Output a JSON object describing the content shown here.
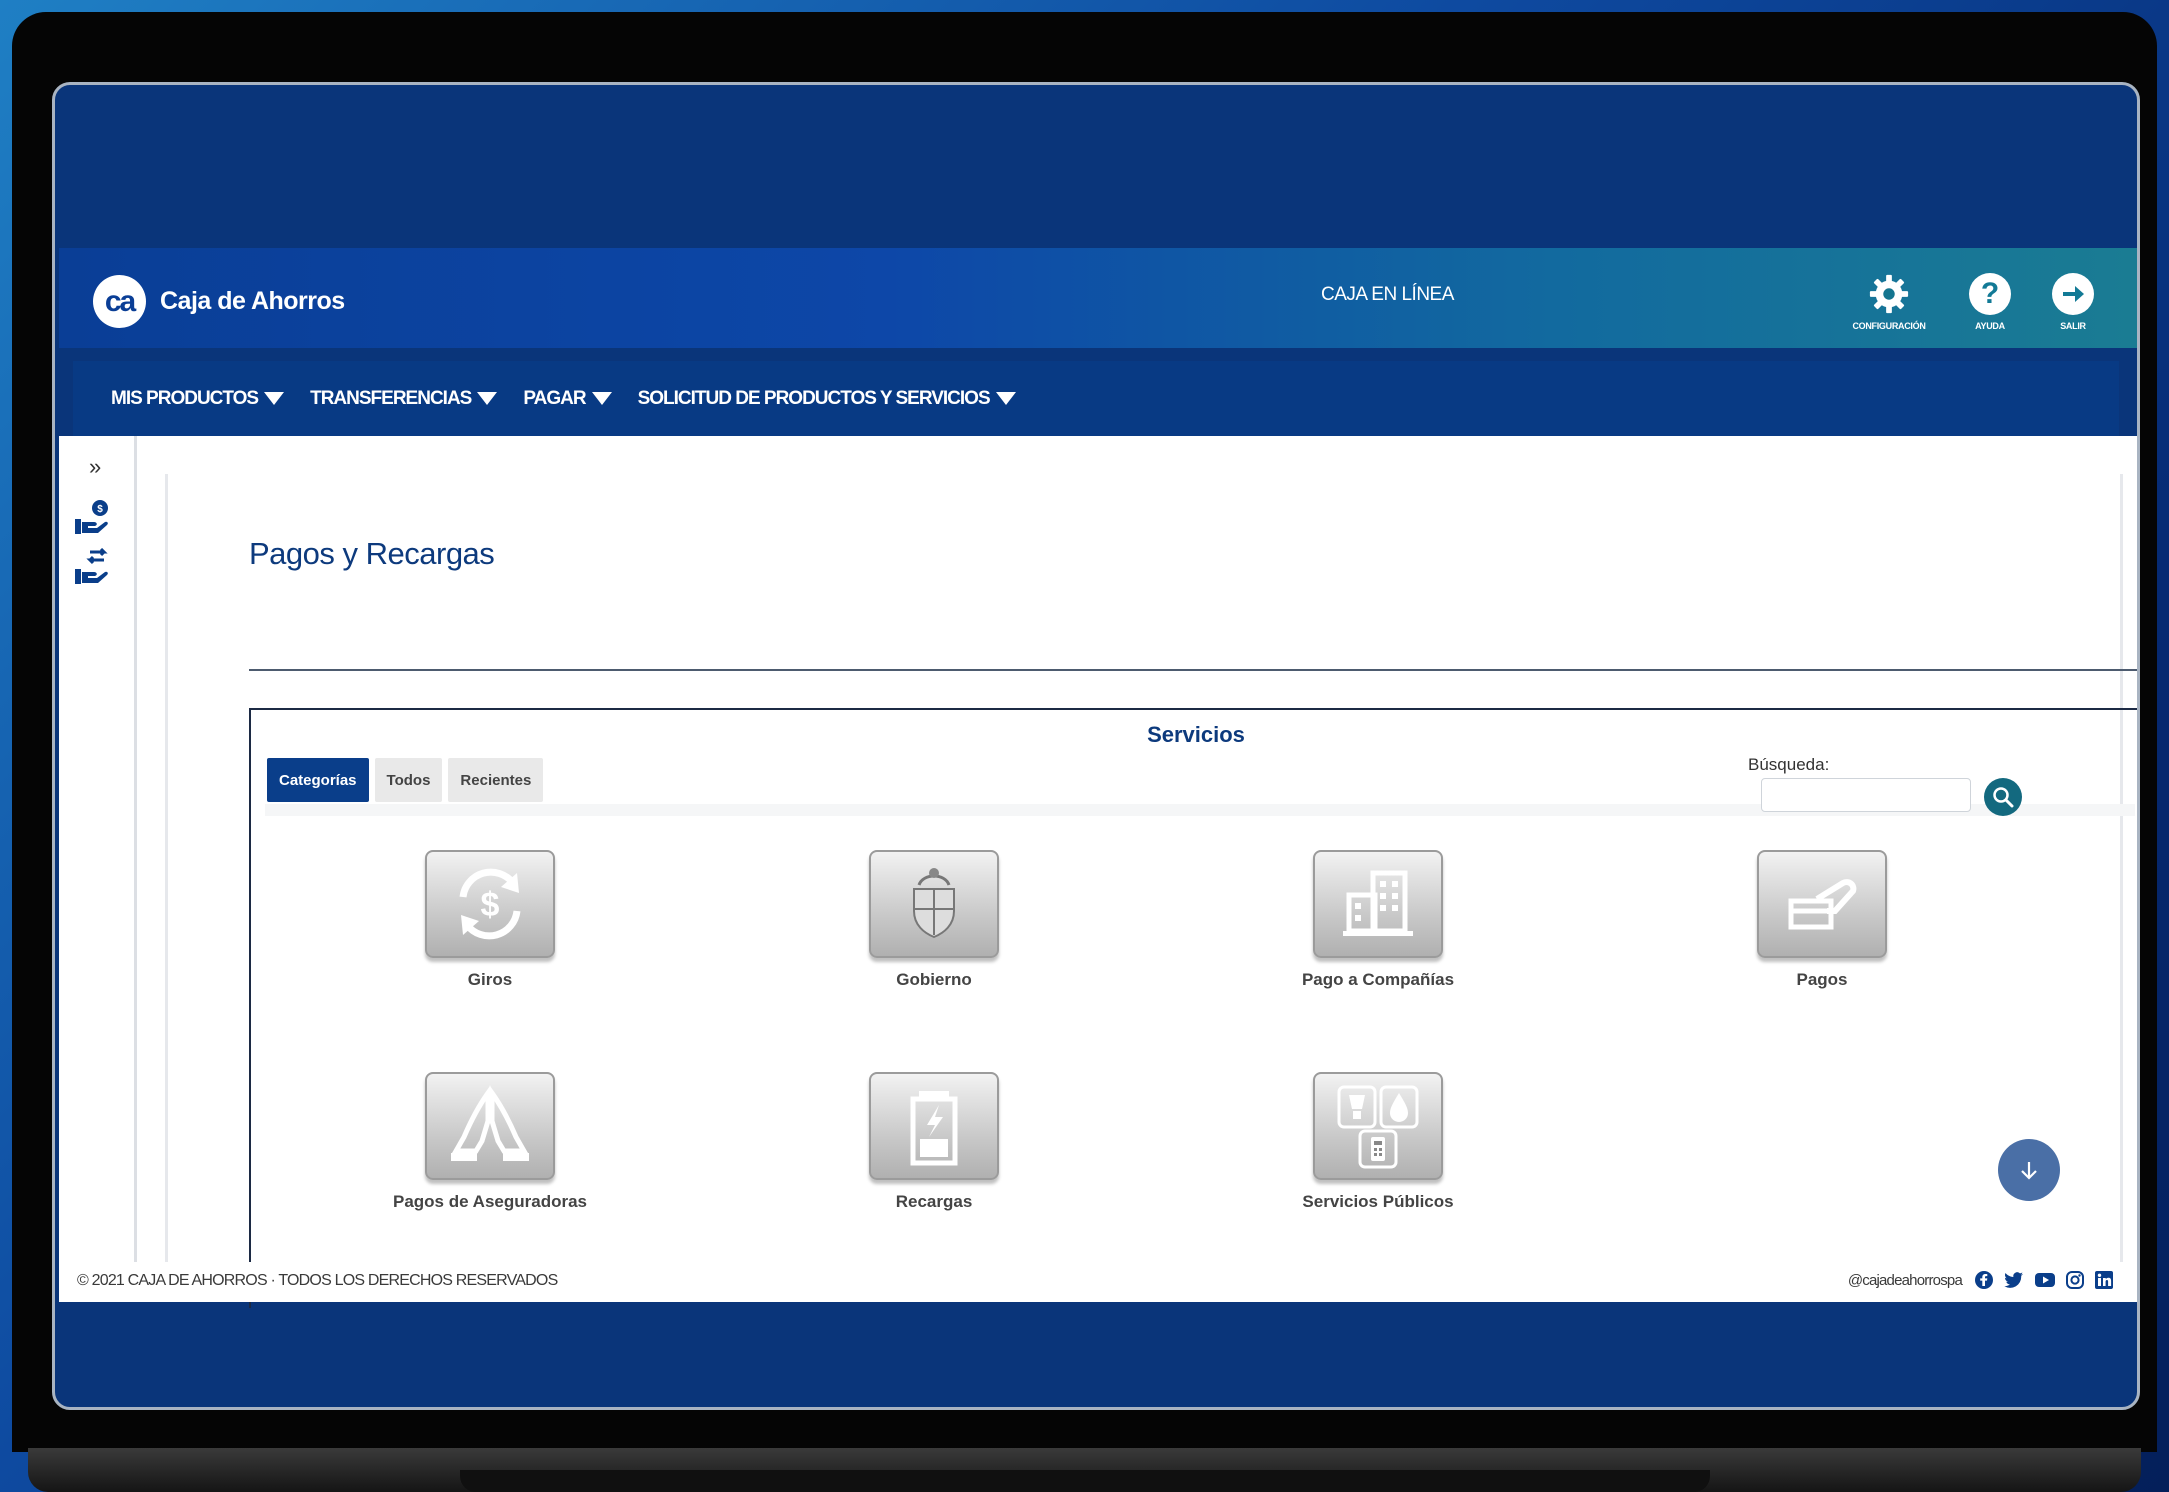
{
  "header": {
    "logo_mark": "ca",
    "logo_text": "Caja de Ahorros",
    "title": "CAJA EN LÍNEA",
    "buttons": [
      {
        "label": "CONFIGURACIÓN",
        "icon": "gear-icon"
      },
      {
        "label": "AYUDA",
        "icon": "help-icon"
      },
      {
        "label": "SALIR",
        "icon": "exit-arrow-icon"
      }
    ]
  },
  "nav": {
    "items": [
      {
        "label": "MIS PRODUCTOS"
      },
      {
        "label": "TRANSFERENCIAS"
      },
      {
        "label": "PAGAR"
      },
      {
        "label": "SOLICITUD DE PRODUCTOS Y SERVICIOS"
      }
    ]
  },
  "sidebar": {
    "toggle": "»",
    "icons": [
      "hand-coin-icon",
      "hand-transfer-icon"
    ]
  },
  "main": {
    "page_title": "Pagos y Recargas",
    "services_title": "Servicios",
    "tabs": [
      {
        "label": "Categorías",
        "active": true
      },
      {
        "label": "Todos",
        "active": false
      },
      {
        "label": "Recientes",
        "active": false
      }
    ],
    "search": {
      "label": "Búsqueda:",
      "value": "",
      "placeholder": ""
    },
    "categories": [
      {
        "label": "Giros",
        "icon": "money-exchange-icon"
      },
      {
        "label": "Gobierno",
        "icon": "coat-of-arms-icon"
      },
      {
        "label": "Pago a Compañías",
        "icon": "buildings-icon"
      },
      {
        "label": "Pagos",
        "icon": "hand-card-icon"
      },
      {
        "label": "Pagos de Aseguradoras",
        "icon": "praying-hands-icon"
      },
      {
        "label": "Recargas",
        "icon": "battery-charge-icon"
      },
      {
        "label": "Servicios Públicos",
        "icon": "utilities-icon"
      }
    ]
  },
  "footer": {
    "copyright": "© 2021 CAJA DE AHORROS · TODOS LOS DERECHOS RESERVADOS",
    "social_handle": "@cajadeahorrospa",
    "social_icons": [
      "facebook-icon",
      "twitter-icon",
      "youtube-icon",
      "instagram-icon",
      "linkedin-icon"
    ]
  },
  "colors": {
    "brand_blue": "#0a3e96",
    "nav_blue": "#083a84",
    "teal": "#13697f",
    "title_blue": "#0d3a7d"
  }
}
